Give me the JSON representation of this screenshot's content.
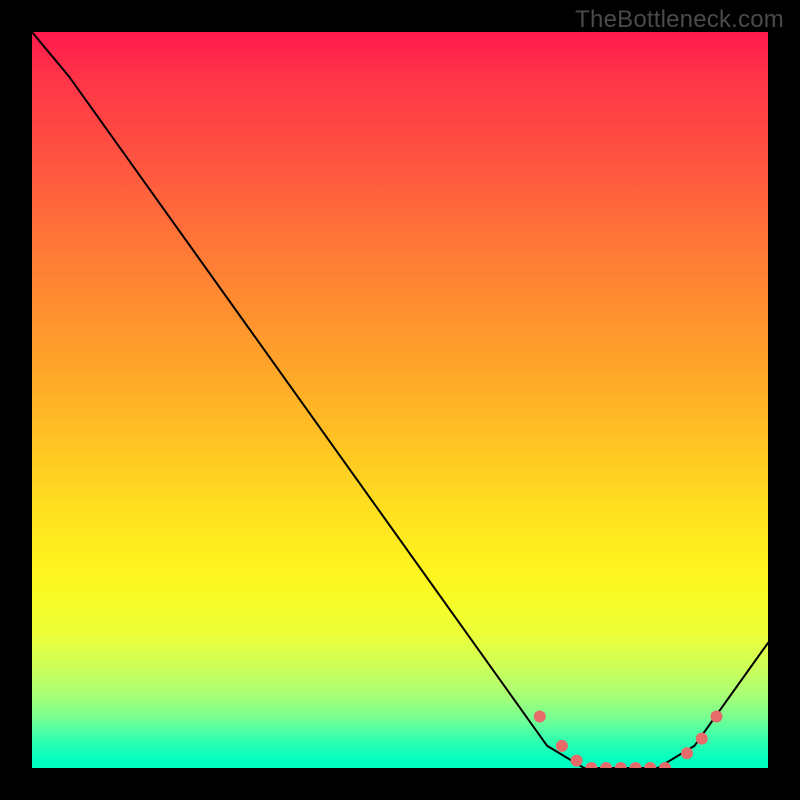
{
  "watermark": "TheBottleneck.com",
  "chart_data": {
    "type": "line",
    "title": "",
    "xlabel": "",
    "ylabel": "",
    "xlim": [
      0,
      100
    ],
    "ylim": [
      0,
      100
    ],
    "grid": false,
    "legend": false,
    "gradient_colors": {
      "top": "#ff1a4d",
      "mid": "#fff21e",
      "bottom": "#00ffc5",
      "description": "red-orange-yellow-green vertical gradient"
    },
    "curve": {
      "color": "#000000",
      "width": 2,
      "points": [
        {
          "x": 0,
          "y": 100
        },
        {
          "x": 5,
          "y": 94
        },
        {
          "x": 10,
          "y": 87
        },
        {
          "x": 65,
          "y": 10
        },
        {
          "x": 70,
          "y": 3
        },
        {
          "x": 75,
          "y": 0
        },
        {
          "x": 80,
          "y": 0
        },
        {
          "x": 85,
          "y": 0
        },
        {
          "x": 90,
          "y": 3
        },
        {
          "x": 100,
          "y": 17
        }
      ]
    },
    "markers": {
      "color": "#e86b6b",
      "radius": 6,
      "points": [
        {
          "x": 69,
          "y": 7
        },
        {
          "x": 72,
          "y": 3
        },
        {
          "x": 74,
          "y": 1
        },
        {
          "x": 76,
          "y": 0
        },
        {
          "x": 78,
          "y": 0
        },
        {
          "x": 80,
          "y": 0
        },
        {
          "x": 82,
          "y": 0
        },
        {
          "x": 84,
          "y": 0
        },
        {
          "x": 86,
          "y": 0
        },
        {
          "x": 89,
          "y": 2
        },
        {
          "x": 91,
          "y": 4
        },
        {
          "x": 93,
          "y": 7
        }
      ]
    }
  }
}
